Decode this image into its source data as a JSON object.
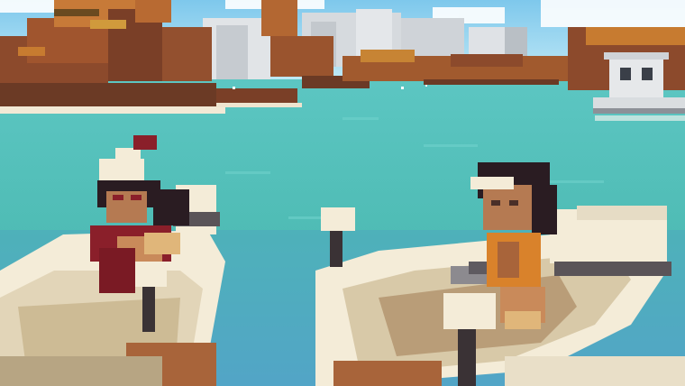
{
  "scene": {
    "description_tag": "voxel-boat-ride",
    "palette": {
      "sky": "#8fd3ee",
      "water_far": "#4fbfb6",
      "water_near": "#5fc7c1",
      "water_shadow": "#4f9ec0",
      "cliff_dark": "#6b3a25",
      "cliff_mid": "#a0552e",
      "cliff_light": "#d08a3d",
      "rock_white": "#d9dde0",
      "boat_white": "#f4ecd8",
      "boat_shadow": "#c9b99a",
      "wood": "#a8643a",
      "skin": "#c98a5a",
      "hair": "#2a1c22",
      "red_shirt": "#8a1f2a",
      "orange_shirt": "#d9822b"
    }
  }
}
